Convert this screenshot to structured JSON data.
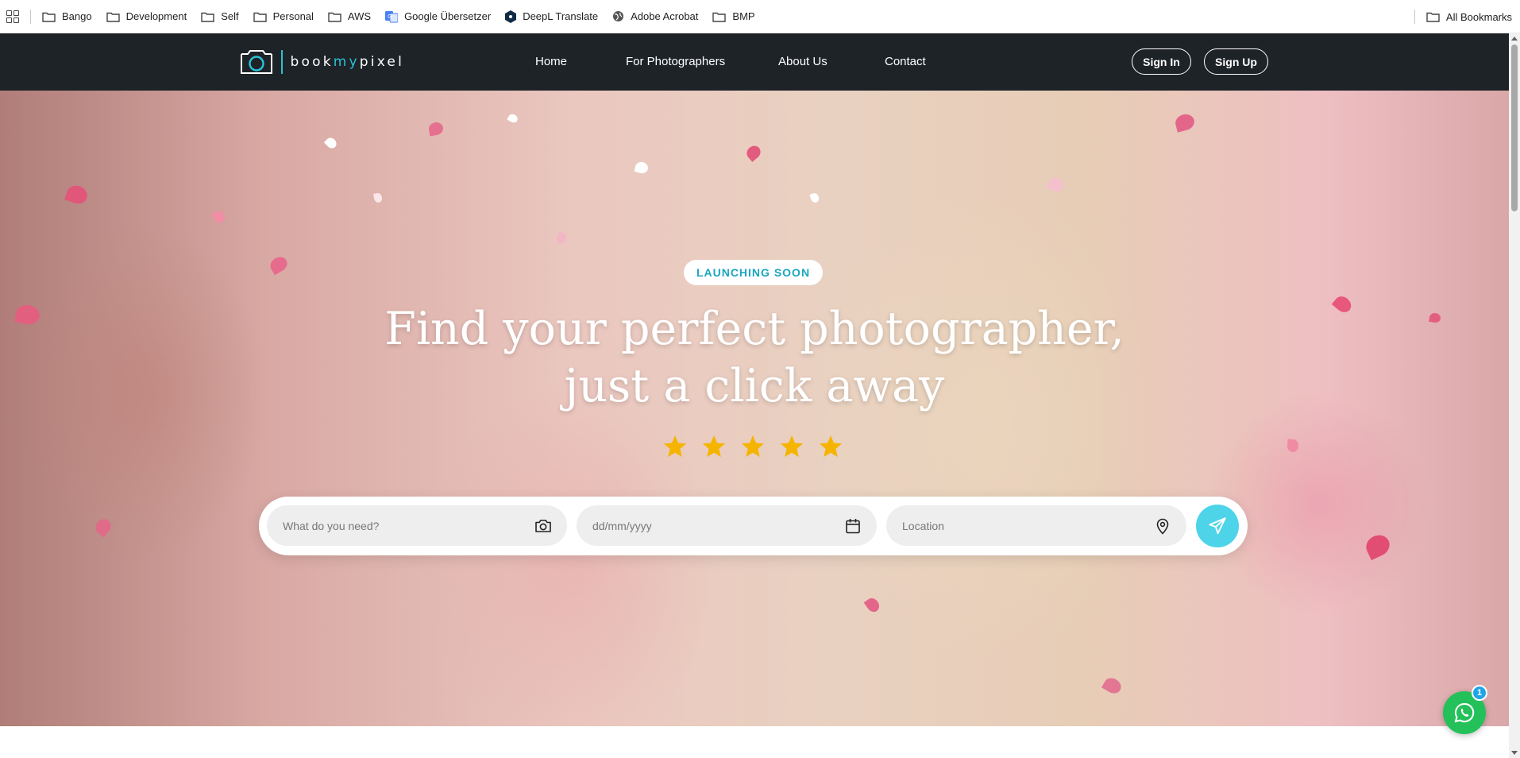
{
  "bookmarks": {
    "items": [
      {
        "label": "Bango",
        "icon": "folder-icon"
      },
      {
        "label": "Development",
        "icon": "folder-icon"
      },
      {
        "label": "Self",
        "icon": "folder-icon"
      },
      {
        "label": "Personal",
        "icon": "folder-icon"
      },
      {
        "label": "AWS",
        "icon": "folder-icon"
      },
      {
        "label": "Google Übersetzer",
        "icon": "google-translate-icon"
      },
      {
        "label": "DeepL Translate",
        "icon": "deepl-icon"
      },
      {
        "label": "Adobe Acrobat",
        "icon": "globe-icon"
      },
      {
        "label": "BMP",
        "icon": "folder-icon"
      }
    ],
    "all_bookmarks": "All Bookmarks"
  },
  "site": {
    "logo": {
      "part1": "book",
      "accent": "my",
      "part2": "pixel"
    },
    "nav": {
      "home": "Home",
      "photographers": "For Photographers",
      "about": "About Us",
      "contact": "Contact",
      "sign_in": "Sign In",
      "sign_up": "Sign Up"
    },
    "accent_color": "#29c3d8",
    "nav_background": "#1e2328"
  },
  "hero": {
    "badge": "LAUNCHING SOON",
    "headline_line1": "Find your perfect photographer,",
    "headline_line2": "just a click away",
    "rating": 5,
    "star_color": "#f5b400"
  },
  "search": {
    "service_placeholder": "What do you need?",
    "date_placeholder": "dd/mm/yyyy",
    "location_placeholder": "Location"
  },
  "whatsapp": {
    "unread_count": "1",
    "color": "#24c05a"
  }
}
